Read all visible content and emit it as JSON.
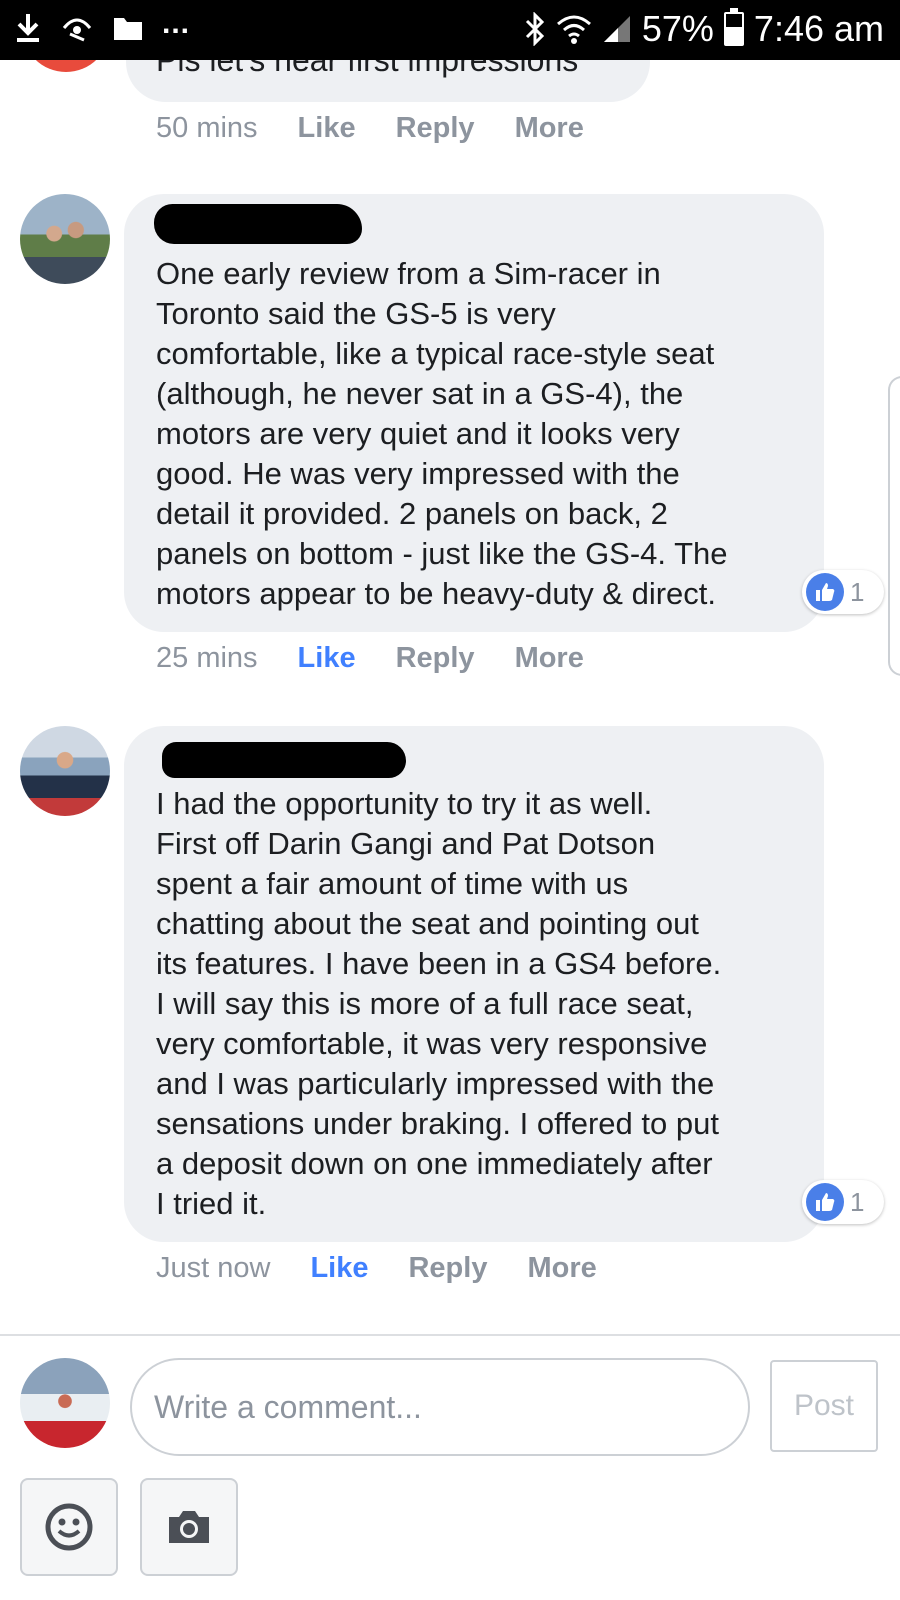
{
  "status_bar": {
    "battery": "57%",
    "time": "7:46 am",
    "overflow": "..."
  },
  "previous_comment": {
    "text": "Pls let's hear first impressions",
    "time": "50 mins",
    "like": "Like",
    "reply": "Reply",
    "more": "More"
  },
  "comments": [
    {
      "text": "One early review from a Sim-racer in\nToronto said the GS-5 is very\ncomfortable, like a typical race-style seat\n(although, he never sat in a GS-4), the\nmotors are very quiet and it looks very\ngood. He was very impressed with the\ndetail it provided. 2 panels on back, 2\npanels on bottom - just like the GS-4. The\nmotors appear to be heavy-duty & direct.",
      "reactions": "1",
      "time": "25 mins",
      "like": "Like",
      "reply": "Reply",
      "more": "More"
    },
    {
      "text": "I had the opportunity to try it as well.\nFirst off Darin Gangi and Pat Dotson\nspent a fair amount of time with us\nchatting about the seat and pointing out\nits features. I have been in a GS4 before.\nI will say this is more of a full race seat,\nvery comfortable, it was very responsive\nand I was particularly impressed with the\nsensations under braking. I offered to put\na deposit down on one immediately after\nI tried it.",
      "reactions": "1",
      "time": "Just now",
      "like": "Like",
      "reply": "Reply",
      "more": "More"
    }
  ],
  "composer": {
    "placeholder": "Write a comment...",
    "post_label": "Post"
  },
  "colors": {
    "like_active": "#4080ff",
    "bubble": "#eef0f3",
    "meta": "#8d949e"
  }
}
